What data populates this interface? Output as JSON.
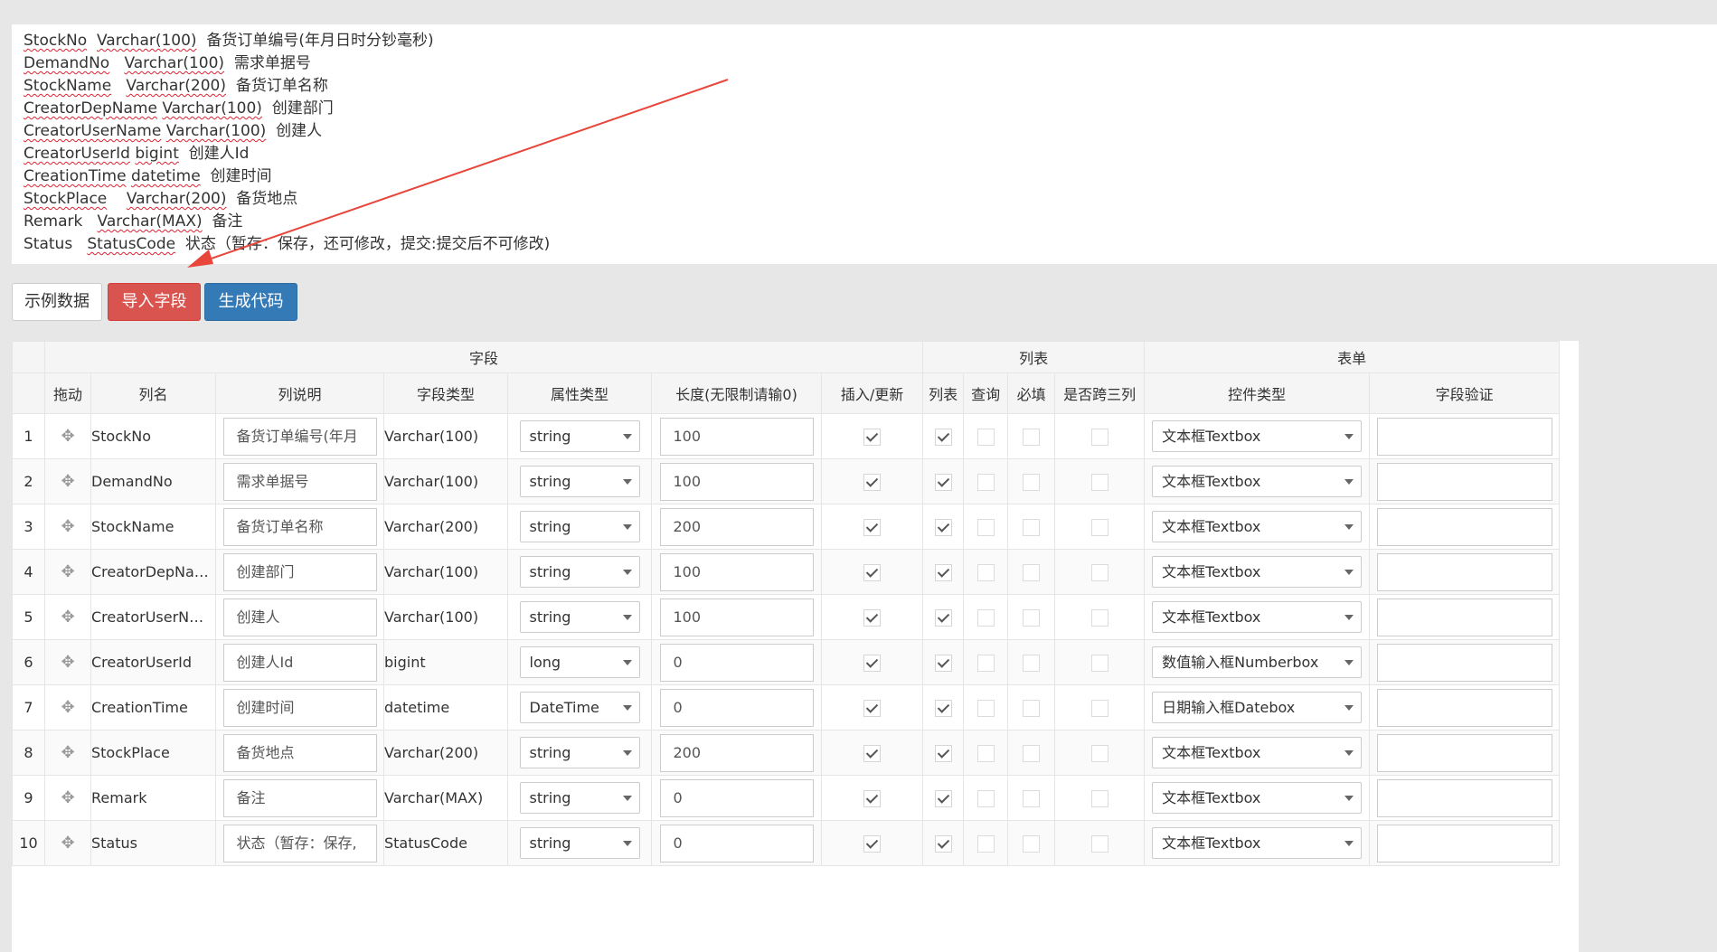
{
  "definitions": [
    {
      "name": "StockNo",
      "type": "Varchar(100)",
      "desc": "备货订单编号(年月日时分钞毫秒)"
    },
    {
      "name": "DemandNo",
      "type": "Varchar(100)",
      "desc": "需求单据号"
    },
    {
      "name": "StockName",
      "type": "Varchar(200)",
      "desc": "备货订单名称"
    },
    {
      "name": "CreatorDepName",
      "type": "Varchar(100)",
      "desc": "创建部门"
    },
    {
      "name": "CreatorUserName",
      "type": "Varchar(100)",
      "desc": "创建人"
    },
    {
      "name": "CreatorUserId",
      "type": "bigint",
      "desc": "创建人Id"
    },
    {
      "name": "CreationTime",
      "type": "datetime",
      "desc": "创建时间"
    },
    {
      "name": "StockPlace",
      "type": "Varchar(200)",
      "desc": "备货地点"
    },
    {
      "name": "Remark",
      "type": "Varchar(MAX)",
      "desc": "备注"
    },
    {
      "name": "Status",
      "type": "StatusCode",
      "desc": "状态（暂存：保存，还可修改，提交:提交后不可修改)"
    }
  ],
  "buttons": {
    "sample": "示例数据",
    "import": "导入字段",
    "generate": "生成代码"
  },
  "table": {
    "groups": {
      "field": "字段",
      "list": "列表",
      "form": "表单"
    },
    "headers": {
      "drag": "拖动",
      "colname": "列名",
      "desc": "列说明",
      "fieldtype": "字段类型",
      "proptype": "属性类型",
      "length": "长度(无限制请输0)",
      "insert": "插入/更新",
      "list": "列表",
      "query": "查询",
      "required": "必填",
      "span3": "是否跨三列",
      "control": "控件类型",
      "verify": "字段验证"
    },
    "rows": [
      {
        "no": "1",
        "name": "StockNo",
        "desc": "备货订单编号(年月",
        "ftype": "Varchar(100)",
        "ptype": "string",
        "len": "100",
        "insert": true,
        "list": true,
        "query": false,
        "required": false,
        "span3": false,
        "control": "文本框Textbox",
        "verify": ""
      },
      {
        "no": "2",
        "name": "DemandNo",
        "desc": "需求单据号",
        "ftype": "Varchar(100)",
        "ptype": "string",
        "len": "100",
        "insert": true,
        "list": true,
        "query": false,
        "required": false,
        "span3": false,
        "control": "文本框Textbox",
        "verify": ""
      },
      {
        "no": "3",
        "name": "StockName",
        "desc": "备货订单名称",
        "ftype": "Varchar(200)",
        "ptype": "string",
        "len": "200",
        "insert": true,
        "list": true,
        "query": false,
        "required": false,
        "span3": false,
        "control": "文本框Textbox",
        "verify": ""
      },
      {
        "no": "4",
        "name": "CreatorDepNa…",
        "desc": "创建部门",
        "ftype": "Varchar(100)",
        "ptype": "string",
        "len": "100",
        "insert": true,
        "list": true,
        "query": false,
        "required": false,
        "span3": false,
        "control": "文本框Textbox",
        "verify": ""
      },
      {
        "no": "5",
        "name": "CreatorUserN…",
        "desc": "创建人",
        "ftype": "Varchar(100)",
        "ptype": "string",
        "len": "100",
        "insert": true,
        "list": true,
        "query": false,
        "required": false,
        "span3": false,
        "control": "文本框Textbox",
        "verify": ""
      },
      {
        "no": "6",
        "name": "CreatorUserId",
        "desc": "创建人Id",
        "ftype": "bigint",
        "ptype": "long",
        "len": "0",
        "insert": true,
        "list": true,
        "query": false,
        "required": false,
        "span3": false,
        "control": "数值输入框Numberbox",
        "verify": ""
      },
      {
        "no": "7",
        "name": "CreationTime",
        "desc": "创建时间",
        "ftype": "datetime",
        "ptype": "DateTime",
        "len": "0",
        "insert": true,
        "list": true,
        "query": false,
        "required": false,
        "span3": false,
        "control": "日期输入框Datebox",
        "verify": ""
      },
      {
        "no": "8",
        "name": "StockPlace",
        "desc": "备货地点",
        "ftype": "Varchar(200)",
        "ptype": "string",
        "len": "200",
        "insert": true,
        "list": true,
        "query": false,
        "required": false,
        "span3": false,
        "control": "文本框Textbox",
        "verify": ""
      },
      {
        "no": "9",
        "name": "Remark",
        "desc": "备注",
        "ftype": "Varchar(MAX)",
        "ptype": "string",
        "len": "0",
        "insert": true,
        "list": true,
        "query": false,
        "required": false,
        "span3": false,
        "control": "文本框Textbox",
        "verify": ""
      },
      {
        "no": "10",
        "name": "Status",
        "desc": "状态（暂存：保存,",
        "ftype": "StatusCode",
        "ptype": "string",
        "len": "0",
        "insert": true,
        "list": true,
        "query": false,
        "required": false,
        "span3": false,
        "control": "文本框Textbox",
        "verify": ""
      }
    ]
  },
  "colors": {
    "arrow": "#e8463b",
    "danger": "#d9534f",
    "primary": "#337ab7"
  }
}
